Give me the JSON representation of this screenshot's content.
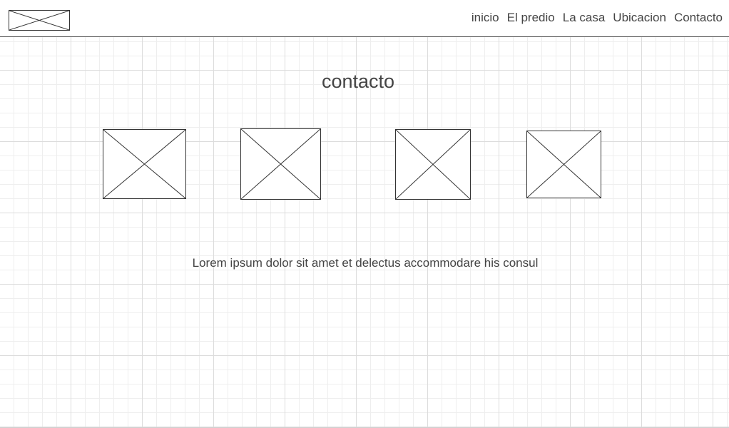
{
  "nav": {
    "items": [
      "inicio",
      "El predio",
      "La casa",
      "Ubicacion",
      "Contacto"
    ]
  },
  "main": {
    "title": "contacto",
    "text": "Lorem ipsum dolor sit amet et delectus accommodare his consul"
  }
}
